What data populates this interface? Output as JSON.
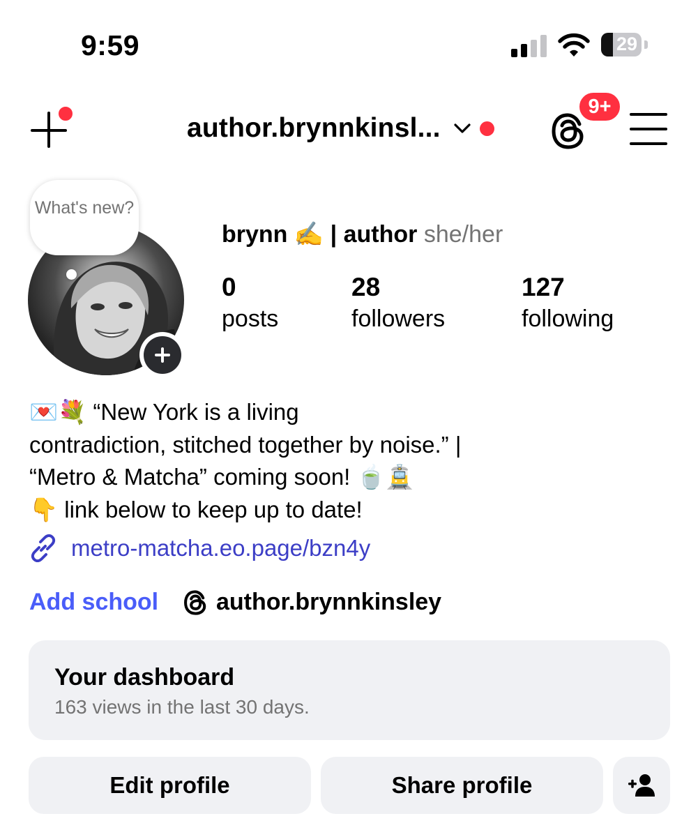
{
  "status_bar": {
    "time": "9:59",
    "battery": "29",
    "battery_level": 0.29,
    "signal_bars_active": 2
  },
  "header": {
    "username": "author.brynnkinsl...",
    "notification_badge": "9+"
  },
  "profile": {
    "bubble_text": "What's new?",
    "display_name": "brynn ✍️ | author",
    "pronouns": "she/her",
    "stats": [
      {
        "value": "0",
        "label": "posts"
      },
      {
        "value": "28",
        "label": "followers"
      },
      {
        "value": "127",
        "label": "following"
      }
    ],
    "bio": "💌💐 “New York is a living\ncontradiction, stitched together by noise.” |\n“Metro & Matcha” coming soon! 🍵🚊\n👇 link below to keep up to date!",
    "link": "metro-matcha.eo.page/bzn4y",
    "add_school": "Add school",
    "threads_handle": "author.brynnkinsley"
  },
  "dashboard": {
    "title": "Your dashboard",
    "subtitle": "163 views in the last 30 days."
  },
  "actions": {
    "edit": "Edit profile",
    "share": "Share profile"
  },
  "colors": {
    "notification": "#ff3040",
    "link": "#3c3ec6",
    "add_school": "#4a5df9",
    "card_bg": "#f0f1f4"
  },
  "icons": [
    "plus-icon",
    "chevron-down-icon",
    "threads-icon",
    "hamburger-menu-icon",
    "link-icon",
    "add-person-icon",
    "wifi-icon",
    "signal-icon",
    "battery-icon"
  ]
}
